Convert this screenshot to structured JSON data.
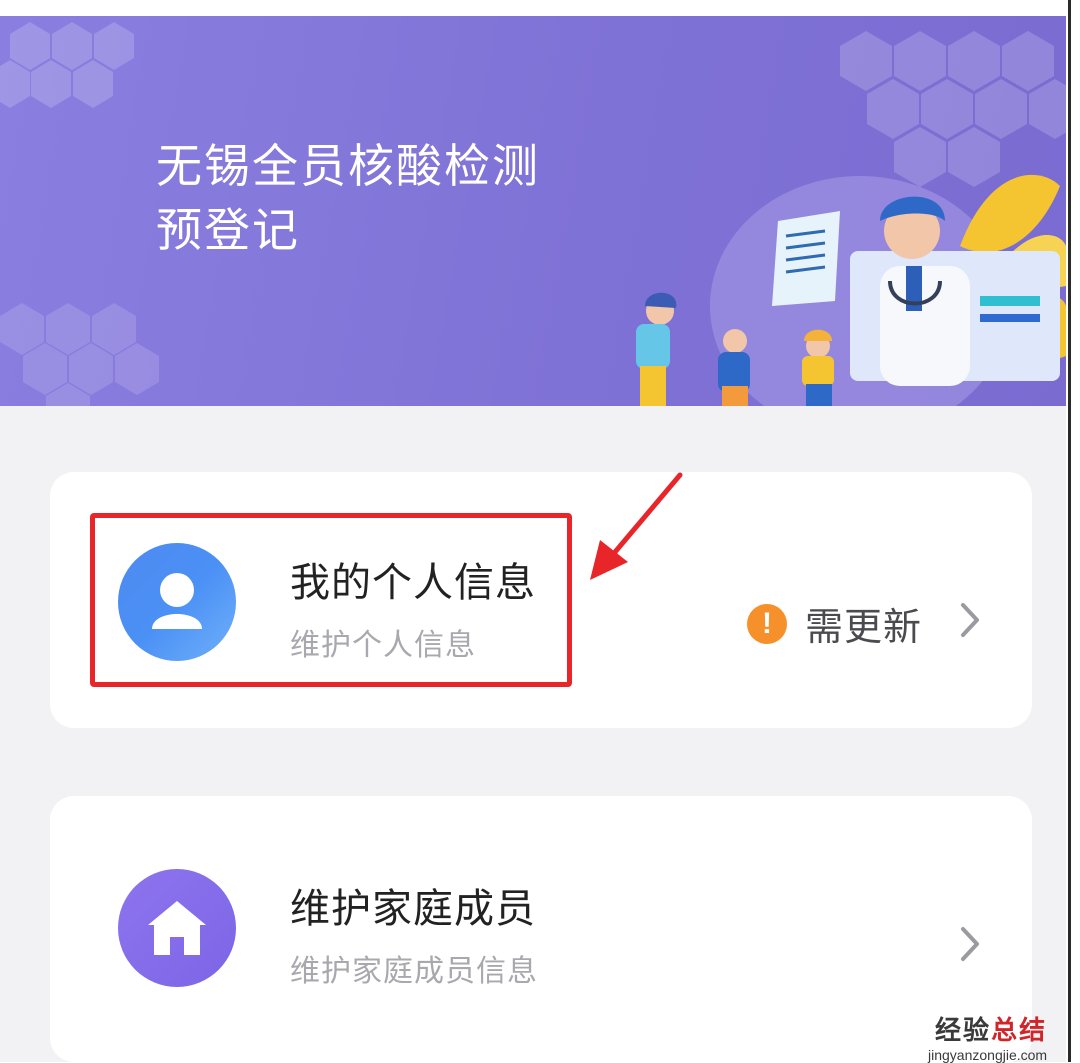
{
  "banner": {
    "title_line1": "无锡全员核酸检测",
    "title_line2": "预登记",
    "background": "#7f72d6"
  },
  "cards": [
    {
      "title": "我的个人信息",
      "subtitle": "维护个人信息",
      "icon": "person-icon",
      "icon_color": "#4a90f5",
      "status": {
        "icon": "exclamation-icon",
        "label": "需更新",
        "color": "#f5902a"
      }
    },
    {
      "title": "维护家庭成员",
      "subtitle": "维护家庭成员信息",
      "icon": "house-icon",
      "icon_color": "#7c65e6"
    }
  ],
  "annotation": {
    "color": "#e8262a"
  },
  "watermark": {
    "text_a": "经验",
    "text_b": "总结",
    "url": "jingyanzongjie.com"
  }
}
